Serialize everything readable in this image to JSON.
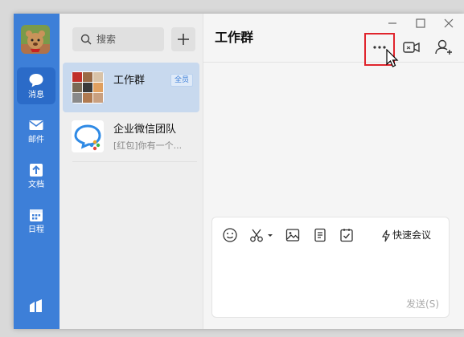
{
  "rail": {
    "items": [
      {
        "label": "消息",
        "icon": "chat-bubble-icon"
      },
      {
        "label": "邮件",
        "icon": "mail-icon"
      },
      {
        "label": "文档",
        "icon": "document-icon"
      },
      {
        "label": "日程",
        "icon": "calendar-icon"
      }
    ],
    "bottom_icon": "workbench-icon"
  },
  "search": {
    "placeholder": "搜索"
  },
  "conversations": [
    {
      "name": "工作群",
      "preview": "",
      "badge": "全员"
    },
    {
      "name": "企业微信团队",
      "preview": "[红包]你有一个..."
    }
  ],
  "chat": {
    "title": "工作群",
    "toolbar_icons": [
      "emoji-icon",
      "scissors-icon",
      "image-icon",
      "file-icon",
      "todo-icon"
    ],
    "quick_meeting": "快速会议",
    "send_label": "发送(S)"
  },
  "colors": {
    "rail": "#3d7fd8",
    "highlight": "#e0242c"
  }
}
